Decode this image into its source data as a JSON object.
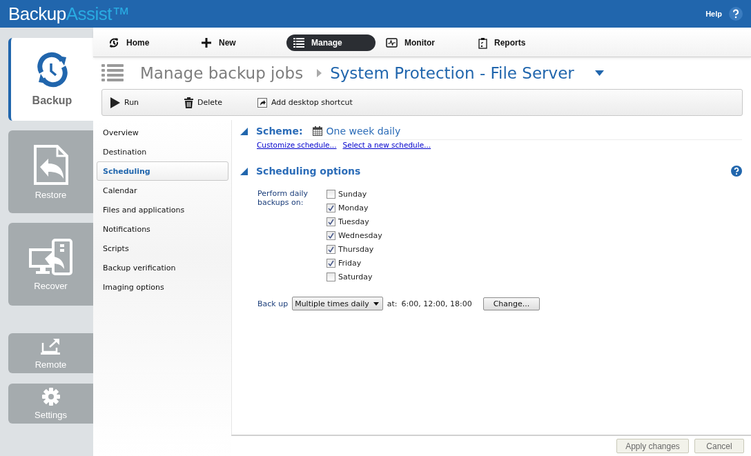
{
  "header": {
    "logo_main": "Backup",
    "logo_accent": "Assist™",
    "help": "Help"
  },
  "rail": [
    {
      "label": "Backup",
      "selected": true
    },
    {
      "label": "Restore",
      "selected": false
    },
    {
      "label": "Recover",
      "selected": false
    },
    {
      "label": "Remote",
      "selected": false
    },
    {
      "label": "Settings",
      "selected": false
    }
  ],
  "nav": [
    {
      "label": "Home",
      "selected": false
    },
    {
      "label": "New",
      "selected": false
    },
    {
      "label": "Manage",
      "selected": true
    },
    {
      "label": "Monitor",
      "selected": false
    },
    {
      "label": "Reports",
      "selected": false
    }
  ],
  "breadcrumb": {
    "parent": "Manage backup jobs",
    "job": "System Protection - File Server"
  },
  "toolbar": [
    "Run",
    "Delete",
    "Add desktop shortcut"
  ],
  "sections": [
    {
      "label": "Overview",
      "selected": false
    },
    {
      "label": "Destination",
      "selected": false
    },
    {
      "label": "Scheduling",
      "selected": true
    },
    {
      "label": "Calendar",
      "selected": false
    },
    {
      "label": "Files and applications",
      "selected": false
    },
    {
      "label": "Notifications",
      "selected": false
    },
    {
      "label": "Scripts",
      "selected": false
    },
    {
      "label": "Backup verification",
      "selected": false
    },
    {
      "label": "Imaging options",
      "selected": false
    }
  ],
  "scheme": {
    "heading": "Scheme:",
    "value": "One week daily",
    "links": [
      "Customize schedule...",
      "Select a new schedule..."
    ]
  },
  "options": {
    "heading": "Scheduling options",
    "days_label": "Perform daily backups on:",
    "days": [
      {
        "label": "Sunday",
        "checked": false
      },
      {
        "label": "Monday",
        "checked": true
      },
      {
        "label": "Tuesday",
        "checked": true
      },
      {
        "label": "Wednesday",
        "checked": true
      },
      {
        "label": "Thursday",
        "checked": true
      },
      {
        "label": "Friday",
        "checked": true
      },
      {
        "label": "Saturday",
        "checked": false
      }
    ],
    "backup_label": "Back up",
    "frequency": "Multiple times daily",
    "at_label": "at:",
    "times": "6:00, 12:00, 18:00",
    "change": "Change..."
  },
  "footer": [
    "Apply changes",
    "Cancel"
  ]
}
